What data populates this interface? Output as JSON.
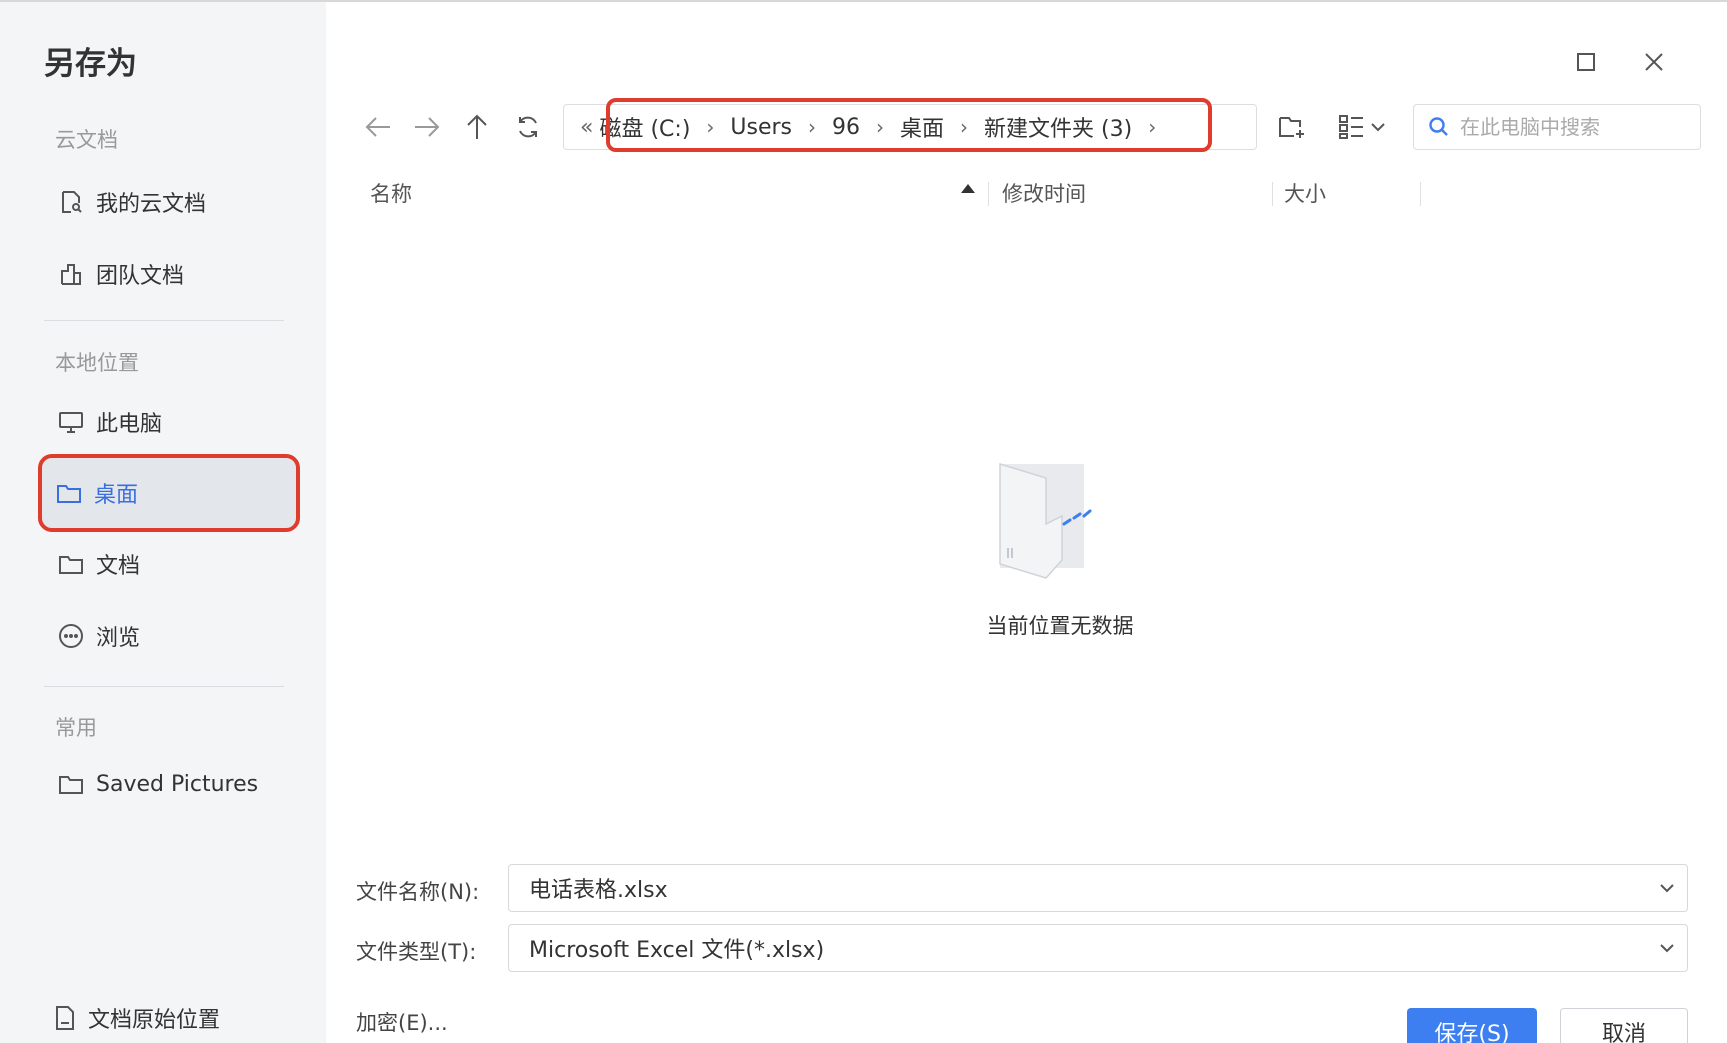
{
  "dialog": {
    "title": "另存为"
  },
  "sidebar": {
    "cloud_section": "云文档",
    "cloud_items": [
      {
        "label": "我的云文档",
        "icon": "cloud-doc-icon"
      },
      {
        "label": "团队文档",
        "icon": "team-doc-icon"
      }
    ],
    "local_section": "本地位置",
    "local_items": [
      {
        "label": "此电脑",
        "icon": "monitor-icon"
      },
      {
        "label": "桌面",
        "icon": "folder-icon",
        "active": true
      },
      {
        "label": "文档",
        "icon": "folder-icon"
      },
      {
        "label": "浏览",
        "icon": "more-circle-icon"
      }
    ],
    "common_section": "常用",
    "common_items": [
      {
        "label": "Saved Pictures",
        "icon": "folder-icon"
      }
    ],
    "bottom_item": {
      "label": "文档原始位置",
      "icon": "document-icon"
    }
  },
  "toolbar": {
    "breadcrumb": [
      "磁盘 (C:)",
      "Users",
      "96",
      "桌面",
      "新建文件夹 (3)"
    ],
    "search_placeholder": "在此电脑中搜索"
  },
  "columns": {
    "name": "名称",
    "modified": "修改时间",
    "size": "大小"
  },
  "empty_state": {
    "text": "当前位置无数据"
  },
  "form": {
    "filename_label": "文件名称(N):",
    "filename_value": "电话表格.xlsx",
    "filetype_label": "文件类型(T):",
    "filetype_value": "Microsoft Excel 文件(*.xlsx)",
    "encrypt_label": "加密(E)...",
    "save_label": "保存(S)",
    "cancel_label": "取消"
  },
  "colors": {
    "accent": "#3d7ef0",
    "highlight": "#e03c2d",
    "sidebar_bg": "#f4f5f7"
  }
}
